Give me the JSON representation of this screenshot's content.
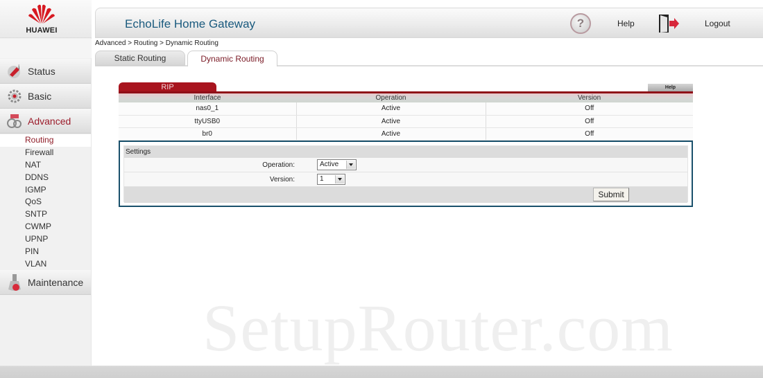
{
  "brand": {
    "name": "HUAWEI",
    "logo_color": "#d71921"
  },
  "header": {
    "title": "EchoLife Home Gateway",
    "help_label": "Help",
    "logout_label": "Logout"
  },
  "breadcrumb": "Advanced > Routing > Dynamic Routing",
  "tabs": [
    {
      "label": "Static Routing",
      "active": false
    },
    {
      "label": "Dynamic Routing",
      "active": true
    }
  ],
  "sidebar": {
    "main": [
      {
        "label": "Status",
        "icon": "status-icon",
        "active": false
      },
      {
        "label": "Basic",
        "icon": "gear-icon",
        "active": false
      },
      {
        "label": "Advanced",
        "icon": "advanced-icon",
        "active": true
      },
      {
        "label": "Maintenance",
        "icon": "maintenance-icon",
        "active": false
      }
    ],
    "advanced_items": [
      {
        "label": "Routing",
        "active": true
      },
      {
        "label": "Firewall"
      },
      {
        "label": "NAT"
      },
      {
        "label": "DDNS"
      },
      {
        "label": "IGMP"
      },
      {
        "label": "QoS"
      },
      {
        "label": "SNTP"
      },
      {
        "label": "CWMP"
      },
      {
        "label": "UPNP"
      },
      {
        "label": "PIN"
      },
      {
        "label": "VLAN"
      }
    ]
  },
  "rip": {
    "tab_label": "RIP",
    "help_label": "Help",
    "columns": [
      "Interface",
      "Operation",
      "Version"
    ],
    "rows": [
      [
        "nas0_1",
        "Active",
        "Off"
      ],
      [
        "ttyUSB0",
        "Active",
        "Off"
      ],
      [
        "br0",
        "Active",
        "Off"
      ]
    ]
  },
  "settings": {
    "title": "Settings",
    "operation_label": "Operation:",
    "operation_value": "Active",
    "version_label": "Version:",
    "version_value": "1",
    "submit_label": "Submit"
  },
  "watermark": "SetupRouter.com",
  "colors": {
    "accent_red": "#a8141e",
    "title_blue": "#1a5a7e",
    "box_border": "#19506b"
  }
}
